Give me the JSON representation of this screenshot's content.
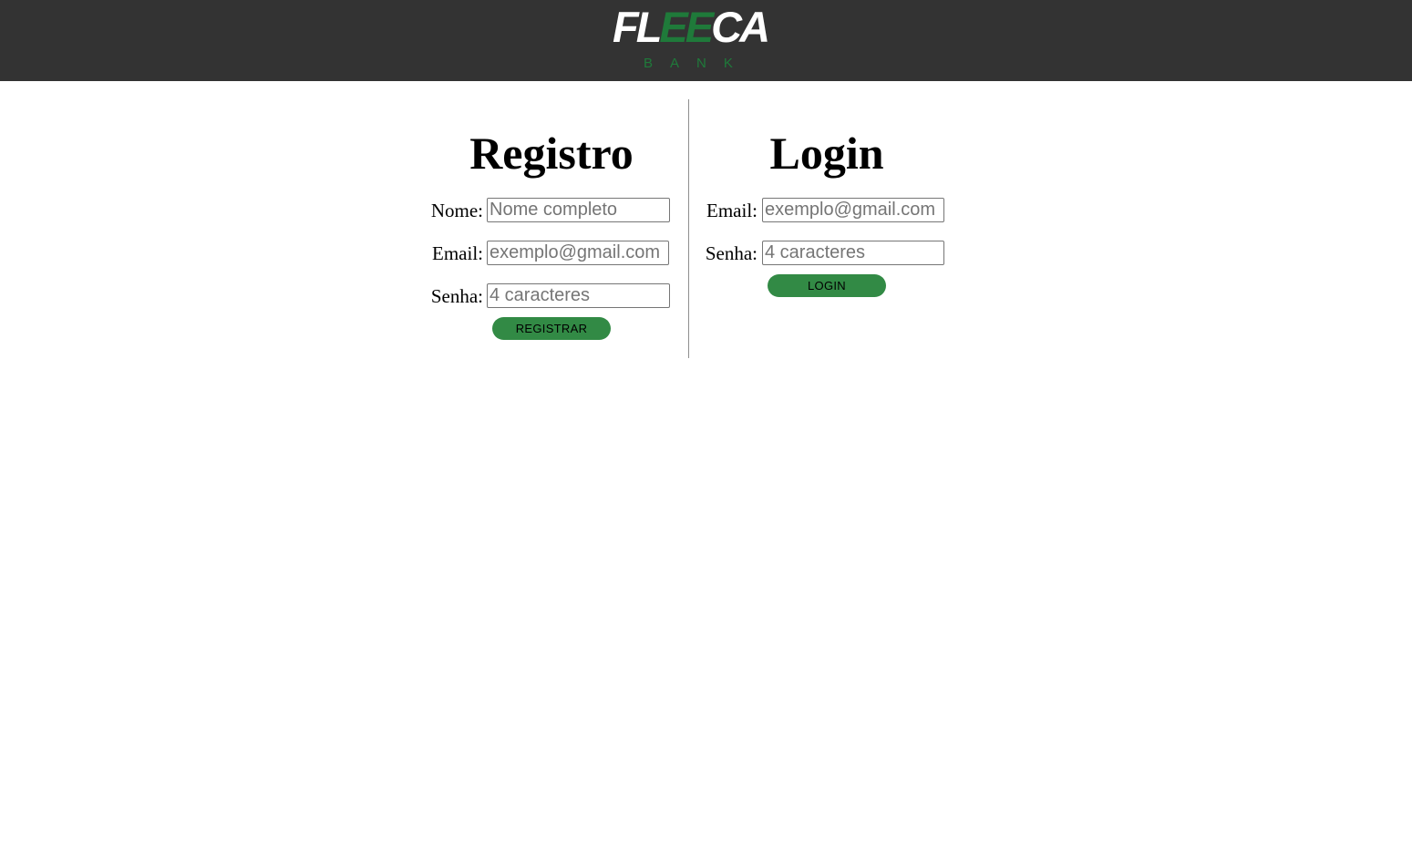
{
  "header": {
    "logo_text": "FLEECA",
    "logo_sub": "BANK"
  },
  "register": {
    "title": "Registro",
    "name_label": "Nome:",
    "name_placeholder": "Nome completo",
    "email_label": "Email:",
    "email_placeholder": "exemplo@gmail.com",
    "password_label": "Senha:",
    "password_placeholder": "4 caracteres",
    "button_label": "REGISTRAR"
  },
  "login": {
    "title": "Login",
    "email_label": "Email:",
    "email_placeholder": "exemplo@gmail.com",
    "password_label": "Senha:",
    "password_placeholder": "4 caracteres",
    "button_label": "LOGIN"
  },
  "colors": {
    "header_bg": "#333333",
    "brand_green": "#1f7a3a",
    "button_green": "#328a45"
  }
}
